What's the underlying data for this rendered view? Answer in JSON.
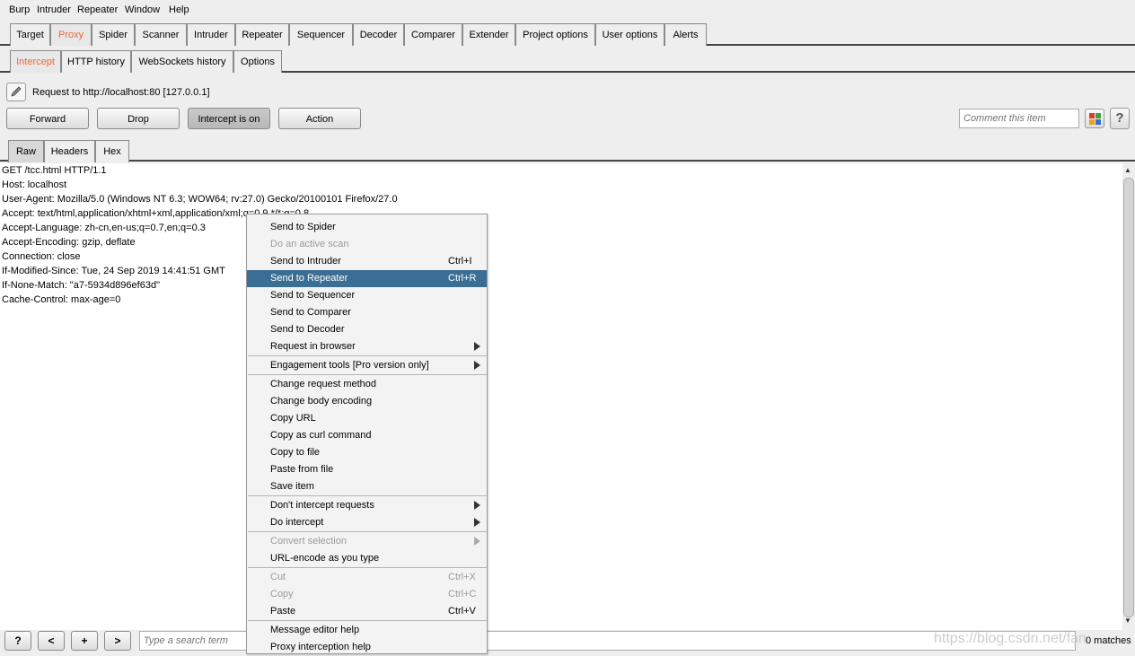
{
  "menubar": [
    "Burp",
    "Intruder",
    "Repeater",
    "Window",
    "Help"
  ],
  "main_tabs": [
    "Target",
    "Proxy",
    "Spider",
    "Scanner",
    "Intruder",
    "Repeater",
    "Sequencer",
    "Decoder",
    "Comparer",
    "Extender",
    "Project options",
    "User options",
    "Alerts"
  ],
  "proxy_tabs": [
    "Intercept",
    "HTTP history",
    "WebSockets history",
    "Options"
  ],
  "request_line": "Request to http://localhost:80  [127.0.0.1]",
  "buttons": {
    "forward": "Forward",
    "drop": "Drop",
    "intercept": "Intercept is on",
    "action": "Action"
  },
  "comment_placeholder": "Comment this item",
  "help_label": "?",
  "editor_tabs": [
    "Raw",
    "Headers",
    "Hex"
  ],
  "request_lines": [
    "GET /tcc.html HTTP/1.1",
    "Host: localhost",
    "User-Agent: Mozilla/5.0 (Windows NT 6.3; WOW64; rv:27.0) Gecko/20100101 Firefox/27.0",
    "Accept: text/html,application/xhtml+xml,application/xml;q=0.9,*/*;q=0.8",
    "Accept-Language: zh-cn,en-us;q=0.7,en;q=0.3",
    "Accept-Encoding: gzip, deflate",
    "Connection: close",
    "If-Modified-Since: Tue, 24 Sep 2019 14:41:51 GMT",
    "If-None-Match: \"a7-5934d896ef63d\"",
    "Cache-Control: max-age=0"
  ],
  "context_menu": [
    {
      "label": "Send to Spider",
      "shortcut": "",
      "disabled": false,
      "submenu": false
    },
    {
      "label": "Do an active scan",
      "shortcut": "",
      "disabled": true,
      "submenu": false
    },
    {
      "label": "Send to Intruder",
      "shortcut": "Ctrl+I",
      "disabled": false,
      "submenu": false
    },
    {
      "label": "Send to Repeater",
      "shortcut": "Ctrl+R",
      "disabled": false,
      "submenu": false,
      "highlighted": true
    },
    {
      "label": "Send to Sequencer",
      "shortcut": "",
      "disabled": false,
      "submenu": false
    },
    {
      "label": "Send to Comparer",
      "shortcut": "",
      "disabled": false,
      "submenu": false
    },
    {
      "label": "Send to Decoder",
      "shortcut": "",
      "disabled": false,
      "submenu": false
    },
    {
      "label": "Request in browser",
      "shortcut": "",
      "disabled": false,
      "submenu": true
    },
    {
      "label": "Engagement tools [Pro version only]",
      "shortcut": "",
      "disabled": false,
      "submenu": true
    },
    {
      "label": "Change request method",
      "shortcut": "",
      "disabled": false,
      "submenu": false
    },
    {
      "label": "Change body encoding",
      "shortcut": "",
      "disabled": false,
      "submenu": false
    },
    {
      "label": "Copy URL",
      "shortcut": "",
      "disabled": false,
      "submenu": false
    },
    {
      "label": "Copy as curl command",
      "shortcut": "",
      "disabled": false,
      "submenu": false
    },
    {
      "label": "Copy to file",
      "shortcut": "",
      "disabled": false,
      "submenu": false
    },
    {
      "label": "Paste from file",
      "shortcut": "",
      "disabled": false,
      "submenu": false
    },
    {
      "label": "Save item",
      "shortcut": "",
      "disabled": false,
      "submenu": false
    },
    {
      "label": "Don't intercept requests",
      "shortcut": "",
      "disabled": false,
      "submenu": true
    },
    {
      "label": "Do intercept",
      "shortcut": "",
      "disabled": false,
      "submenu": true
    },
    {
      "label": "Convert selection",
      "shortcut": "",
      "disabled": true,
      "submenu": true
    },
    {
      "label": "URL-encode as you type",
      "shortcut": "",
      "disabled": false,
      "submenu": false
    },
    {
      "label": "Cut",
      "shortcut": "Ctrl+X",
      "disabled": true,
      "submenu": false
    },
    {
      "label": "Copy",
      "shortcut": "Ctrl+C",
      "disabled": true,
      "submenu": false
    },
    {
      "label": "Paste",
      "shortcut": "Ctrl+V",
      "disabled": false,
      "submenu": false
    },
    {
      "label": "Message editor help",
      "shortcut": "",
      "disabled": false,
      "submenu": false
    },
    {
      "label": "Proxy interception help",
      "shortcut": "",
      "disabled": false,
      "submenu": false
    }
  ],
  "search": {
    "help": "?",
    "prev": "<",
    "add": "+",
    "next": ">",
    "placeholder": "Type a search term",
    "matches": "0 matches"
  },
  "watermark": "https://blog.csdn.net/fan",
  "colors": {
    "accent": "#ee6633",
    "highlight": "#3b6e94"
  }
}
